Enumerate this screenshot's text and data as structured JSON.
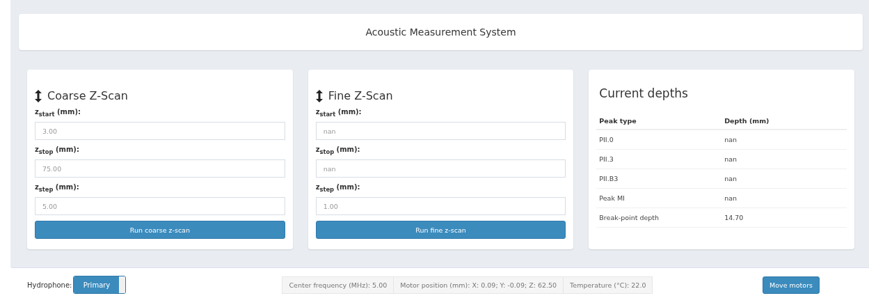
{
  "header": {
    "title": "Acoustic Measurement System"
  },
  "scans": [
    {
      "title": "Coarse Z-Scan",
      "fields": [
        {
          "label": "z$_{start}$ (mm):",
          "placeholder": "3.00"
        },
        {
          "label": "z$_{stop}$ (mm):",
          "placeholder": "75.00"
        },
        {
          "label": "z$_{step}$ (mm):",
          "placeholder": "5.00"
        }
      ],
      "button": "Run coarse z-scan"
    },
    {
      "title": "Fine Z-Scan",
      "fields": [
        {
          "label": "z$_{start}$ (mm):",
          "placeholder": "nan"
        },
        {
          "label": "z$_{stop}$ (mm):",
          "placeholder": "nan"
        },
        {
          "label": "z$_{step}$ (mm):",
          "placeholder": "1.00"
        }
      ],
      "button": "Run fine z-scan"
    }
  ],
  "depths": {
    "title": "Current depths",
    "columns": [
      "Peak type",
      "Depth (mm)"
    ],
    "rows": [
      [
        "PII.0",
        "nan"
      ],
      [
        "PII.3",
        "nan"
      ],
      [
        "PII.B3",
        "nan"
      ],
      [
        "Peak MI",
        "nan"
      ],
      [
        "Break-point depth",
        "14.70"
      ]
    ]
  },
  "footer": {
    "hydrophone_label": "Hydrophone:",
    "toggle": {
      "label": "Primary",
      "on": true
    },
    "status": [
      "Center frequency (MHz): 5.00",
      "Motor position (mm): X: 0.09; Y: -0.09; Z: 62.50",
      "Temperature (°C): 22.0"
    ],
    "button": "Move motors"
  }
}
